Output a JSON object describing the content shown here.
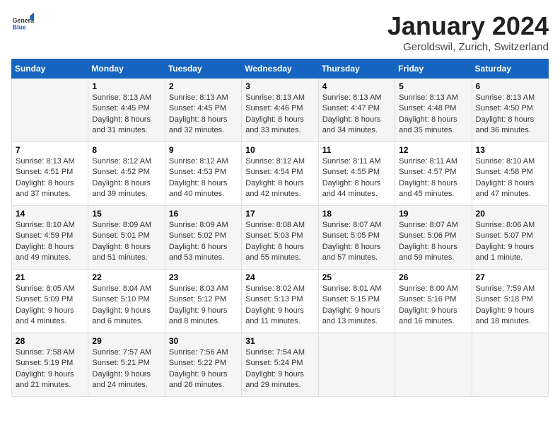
{
  "header": {
    "logo_general": "General",
    "logo_blue": "Blue",
    "month": "January 2024",
    "location": "Geroldswil, Zurich, Switzerland"
  },
  "weekdays": [
    "Sunday",
    "Monday",
    "Tuesday",
    "Wednesday",
    "Thursday",
    "Friday",
    "Saturday"
  ],
  "weeks": [
    [
      {
        "day": "",
        "info": ""
      },
      {
        "day": "1",
        "info": "Sunrise: 8:13 AM\nSunset: 4:45 PM\nDaylight: 8 hours\nand 31 minutes."
      },
      {
        "day": "2",
        "info": "Sunrise: 8:13 AM\nSunset: 4:45 PM\nDaylight: 8 hours\nand 32 minutes."
      },
      {
        "day": "3",
        "info": "Sunrise: 8:13 AM\nSunset: 4:46 PM\nDaylight: 8 hours\nand 33 minutes."
      },
      {
        "day": "4",
        "info": "Sunrise: 8:13 AM\nSunset: 4:47 PM\nDaylight: 8 hours\nand 34 minutes."
      },
      {
        "day": "5",
        "info": "Sunrise: 8:13 AM\nSunset: 4:48 PM\nDaylight: 8 hours\nand 35 minutes."
      },
      {
        "day": "6",
        "info": "Sunrise: 8:13 AM\nSunset: 4:50 PM\nDaylight: 8 hours\nand 36 minutes."
      }
    ],
    [
      {
        "day": "7",
        "info": "Sunrise: 8:13 AM\nSunset: 4:51 PM\nDaylight: 8 hours\nand 37 minutes."
      },
      {
        "day": "8",
        "info": "Sunrise: 8:12 AM\nSunset: 4:52 PM\nDaylight: 8 hours\nand 39 minutes."
      },
      {
        "day": "9",
        "info": "Sunrise: 8:12 AM\nSunset: 4:53 PM\nDaylight: 8 hours\nand 40 minutes."
      },
      {
        "day": "10",
        "info": "Sunrise: 8:12 AM\nSunset: 4:54 PM\nDaylight: 8 hours\nand 42 minutes."
      },
      {
        "day": "11",
        "info": "Sunrise: 8:11 AM\nSunset: 4:55 PM\nDaylight: 8 hours\nand 44 minutes."
      },
      {
        "day": "12",
        "info": "Sunrise: 8:11 AM\nSunset: 4:57 PM\nDaylight: 8 hours\nand 45 minutes."
      },
      {
        "day": "13",
        "info": "Sunrise: 8:10 AM\nSunset: 4:58 PM\nDaylight: 8 hours\nand 47 minutes."
      }
    ],
    [
      {
        "day": "14",
        "info": "Sunrise: 8:10 AM\nSunset: 4:59 PM\nDaylight: 8 hours\nand 49 minutes."
      },
      {
        "day": "15",
        "info": "Sunrise: 8:09 AM\nSunset: 5:01 PM\nDaylight: 8 hours\nand 51 minutes."
      },
      {
        "day": "16",
        "info": "Sunrise: 8:09 AM\nSunset: 5:02 PM\nDaylight: 8 hours\nand 53 minutes."
      },
      {
        "day": "17",
        "info": "Sunrise: 8:08 AM\nSunset: 5:03 PM\nDaylight: 8 hours\nand 55 minutes."
      },
      {
        "day": "18",
        "info": "Sunrise: 8:07 AM\nSunset: 5:05 PM\nDaylight: 8 hours\nand 57 minutes."
      },
      {
        "day": "19",
        "info": "Sunrise: 8:07 AM\nSunset: 5:06 PM\nDaylight: 8 hours\nand 59 minutes."
      },
      {
        "day": "20",
        "info": "Sunrise: 8:06 AM\nSunset: 5:07 PM\nDaylight: 9 hours\nand 1 minute."
      }
    ],
    [
      {
        "day": "21",
        "info": "Sunrise: 8:05 AM\nSunset: 5:09 PM\nDaylight: 9 hours\nand 4 minutes."
      },
      {
        "day": "22",
        "info": "Sunrise: 8:04 AM\nSunset: 5:10 PM\nDaylight: 9 hours\nand 6 minutes."
      },
      {
        "day": "23",
        "info": "Sunrise: 8:03 AM\nSunset: 5:12 PM\nDaylight: 9 hours\nand 8 minutes."
      },
      {
        "day": "24",
        "info": "Sunrise: 8:02 AM\nSunset: 5:13 PM\nDaylight: 9 hours\nand 11 minutes."
      },
      {
        "day": "25",
        "info": "Sunrise: 8:01 AM\nSunset: 5:15 PM\nDaylight: 9 hours\nand 13 minutes."
      },
      {
        "day": "26",
        "info": "Sunrise: 8:00 AM\nSunset: 5:16 PM\nDaylight: 9 hours\nand 16 minutes."
      },
      {
        "day": "27",
        "info": "Sunrise: 7:59 AM\nSunset: 5:18 PM\nDaylight: 9 hours\nand 18 minutes."
      }
    ],
    [
      {
        "day": "28",
        "info": "Sunrise: 7:58 AM\nSunset: 5:19 PM\nDaylight: 9 hours\nand 21 minutes."
      },
      {
        "day": "29",
        "info": "Sunrise: 7:57 AM\nSunset: 5:21 PM\nDaylight: 9 hours\nand 24 minutes."
      },
      {
        "day": "30",
        "info": "Sunrise: 7:56 AM\nSunset: 5:22 PM\nDaylight: 9 hours\nand 26 minutes."
      },
      {
        "day": "31",
        "info": "Sunrise: 7:54 AM\nSunset: 5:24 PM\nDaylight: 9 hours\nand 29 minutes."
      },
      {
        "day": "",
        "info": ""
      },
      {
        "day": "",
        "info": ""
      },
      {
        "day": "",
        "info": ""
      }
    ]
  ]
}
